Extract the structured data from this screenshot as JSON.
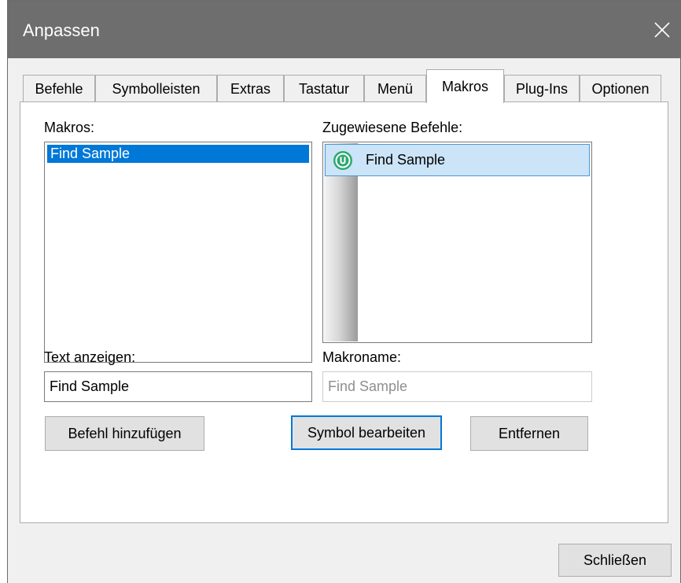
{
  "window": {
    "title": "Anpassen",
    "close_icon": "close-icon"
  },
  "tabs": [
    {
      "label": "Befehle"
    },
    {
      "label": "Symbolleisten"
    },
    {
      "label": "Extras"
    },
    {
      "label": "Tastatur"
    },
    {
      "label": "Menü"
    },
    {
      "label": "Makros",
      "active": true
    },
    {
      "label": "Plug-Ins"
    },
    {
      "label": "Optionen"
    }
  ],
  "macros": {
    "label": "Makros:",
    "items": [
      "Find Sample"
    ],
    "selected": "Find Sample"
  },
  "assigned": {
    "label": "Zugewiesene Befehle:",
    "items": [
      {
        "label": "Find Sample",
        "icon": "macro-icon"
      }
    ]
  },
  "display_text": {
    "label": "Text anzeigen:",
    "value": "Find Sample"
  },
  "macro_name": {
    "label": "Makroname:",
    "value": "Find Sample",
    "disabled": true
  },
  "buttons": {
    "add": "Befehl hinzufügen",
    "edit_icon": "Symbol bearbeiten",
    "remove": "Entfernen",
    "close": "Schließen"
  },
  "colors": {
    "accent": "#0078d7",
    "titlebar": "#6e6e6e",
    "selection_light": "#cce4f7",
    "icon_green": "#2fa870"
  }
}
